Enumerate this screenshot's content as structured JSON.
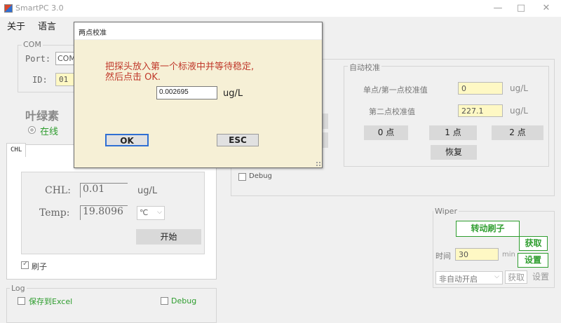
{
  "window": {
    "title": "SmartPC 3.0",
    "minimize": "—",
    "maximize": "□",
    "close": "✕"
  },
  "menu": {
    "about": "关于",
    "language": "语言"
  },
  "com": {
    "title": "COM",
    "port_label": "Port:",
    "port_value": "COM",
    "id_label": "ID:",
    "id_value": "01"
  },
  "sensor": {
    "name": "叶绿素",
    "status": "在线"
  },
  "chl_tab": {
    "label": "CHL"
  },
  "chl_panel": {
    "chl_label": "CHL:",
    "chl_value": "0.01",
    "chl_unit": "ug/L",
    "temp_label": "Temp:",
    "temp_value": "19.8096",
    "temp_unit": "℃",
    "start_button": "开始",
    "brush_checkbox": "刷子"
  },
  "log": {
    "title": "Log",
    "save_excel": "保存到Excel",
    "debug": "Debug"
  },
  "middle_debug": "Debug",
  "auto_cal": {
    "title": "自动校准",
    "point1_label": "单点/第一点校准值",
    "point1_value": "0",
    "point1_unit": "ug/L",
    "point2_label": "第二点校准值",
    "point2_value": "227.1",
    "point2_unit": "ug/L",
    "zero_button": "0 点",
    "one_button": "1 点",
    "two_button": "2 点",
    "restore_button": "恢复"
  },
  "wiper": {
    "title": "Wiper",
    "rotate_button": "转动刷子",
    "get_button": "获取",
    "time_label": "时间",
    "time_value": "30",
    "time_unit": "min",
    "set_button": "设置",
    "mode_select": "非自动开启",
    "get_link": "获取",
    "set_link": "设置"
  },
  "dialog": {
    "title": "两点校准",
    "message_line1": "把探头放入第一个标液中并等待稳定,",
    "message_line2": "然后点击 OK.",
    "input_value": "0.002695",
    "unit": "ug/L",
    "ok": "OK",
    "esc": "ESC"
  }
}
